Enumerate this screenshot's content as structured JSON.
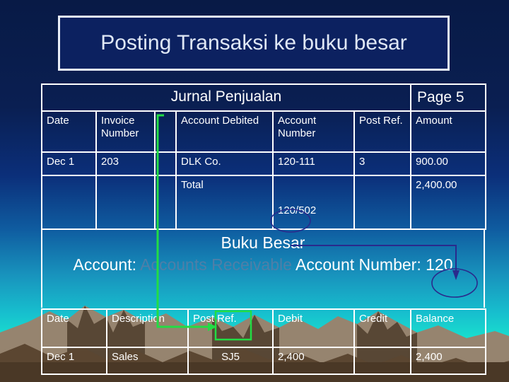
{
  "slide": {
    "title": "Posting Transaksi ke buku besar"
  },
  "journal": {
    "heading": "Jurnal Penjualan",
    "page_label": "Page 5",
    "columns": [
      "Date",
      "Invoice Number",
      "",
      "Account Debited",
      "Account Number",
      "Post Ref.",
      "Amount"
    ],
    "rows": [
      {
        "date": "Dec 1",
        "invoice": "203",
        "spacer": "",
        "account_debited": "DLK Co.",
        "account_number": "120-111",
        "post_ref": "3",
        "amount": "900.00"
      },
      {
        "date": "",
        "invoice": "",
        "spacer": "",
        "account_debited": "Total",
        "account_number": "120/502",
        "post_ref": "",
        "amount": "2,400.00"
      }
    ]
  },
  "ledger": {
    "title": "Buku Besar",
    "account_label": "Account:",
    "account_name": "Accounts Receivable",
    "account_number_label": "Account Number:",
    "account_number": "120",
    "columns": [
      "Date",
      "Description",
      "Post  Ref.",
      "Debit",
      "Credit",
      "Balance"
    ],
    "rows": [
      {
        "date": "Dec 1",
        "description": "Sales",
        "post_ref": "SJ5",
        "debit": "2,400",
        "credit": "",
        "balance": "2,400"
      }
    ]
  },
  "annotations": {
    "green_arrow_name": "post-ref-callout-arrow",
    "green_box_name": "post-ref-highlight-box",
    "purple_arrow_name": "account-number-callout-arrow",
    "green_color": "#22dd44",
    "purple_color": "#2a2a8c"
  },
  "colors": {
    "table_border": "#ffffff",
    "text": "#ffffff",
    "title_text": "#dfe7f5",
    "dim_account": "#4f7fa8",
    "bg_top": "#081a46",
    "bg_bottom": "#1ef0d2",
    "mountain_far": "#8b7a68",
    "mountain_near": "#5a4632"
  }
}
